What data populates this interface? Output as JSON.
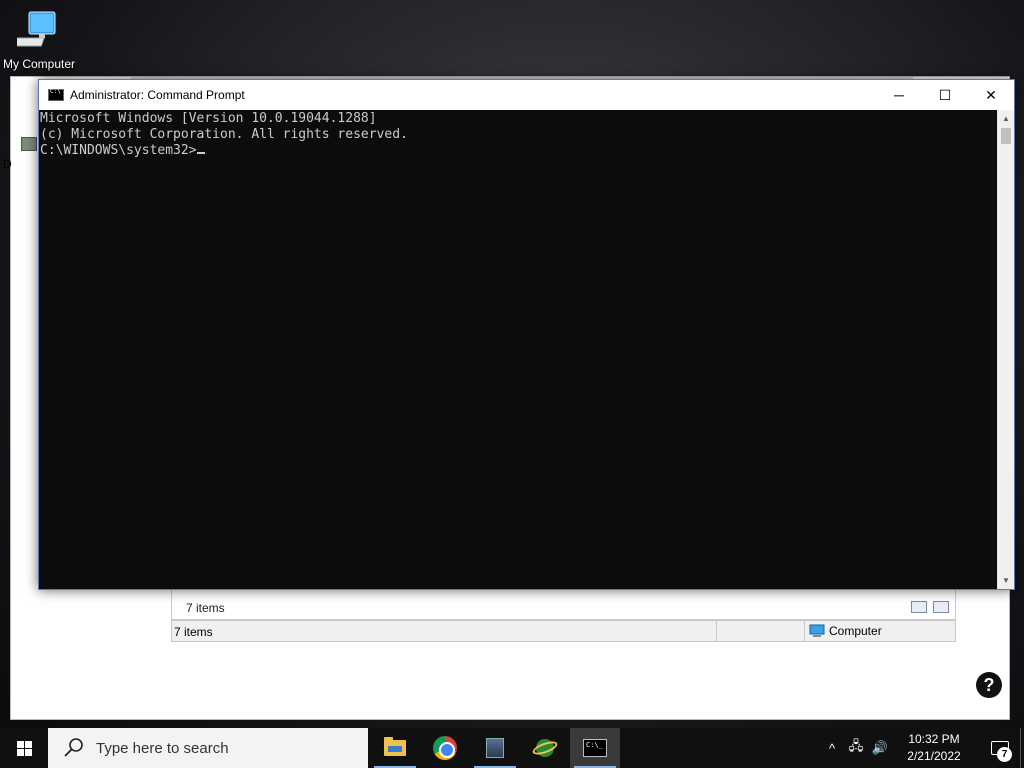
{
  "desktop": {
    "my_computer_label": "My Computer",
    "side_letter": "D"
  },
  "cmd_window": {
    "title": "Administrator: Command Prompt",
    "lines": [
      "Microsoft Windows [Version 10.0.19044.1288]",
      "(c) Microsoft Corporation. All rights reserved.",
      "",
      "C:\\WINDOWS\\system32>"
    ],
    "minimize_glyph": "─",
    "maximize_glyph": "☐",
    "close_glyph": "✕"
  },
  "explorer_window": {
    "pane_items": "7 items",
    "status_items": "7 items",
    "status_location": "Computer",
    "help_glyph": "?"
  },
  "taskbar": {
    "search_placeholder": "Type here to search",
    "pinned": [
      {
        "icon": "file-explorer-icon"
      },
      {
        "icon": "chrome-icon"
      },
      {
        "icon": "app-icon"
      },
      {
        "icon": "internet-download-icon"
      },
      {
        "icon": "command-prompt-icon",
        "active": true
      }
    ],
    "tray": {
      "chevron": "^",
      "network": "🖧",
      "volume": "🔊"
    },
    "time": "10:32 PM",
    "date": "2/21/2022",
    "notification_count": "7"
  }
}
